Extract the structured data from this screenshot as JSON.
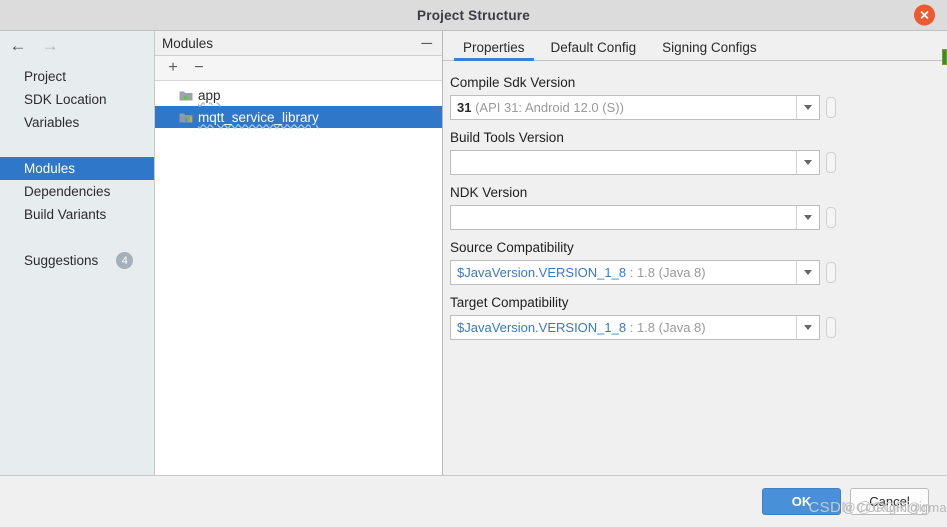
{
  "window": {
    "title": "Project Structure",
    "close_icon": "close-icon"
  },
  "navigation": {
    "back_icon": "arrow-left-icon",
    "forward_icon": "arrow-right-icon",
    "back_label": "←",
    "forward_label": "→"
  },
  "sidebar": {
    "items": [
      {
        "label": "Project",
        "selected": false
      },
      {
        "label": "SDK Location",
        "selected": false
      },
      {
        "label": "Variables",
        "selected": false
      },
      {
        "label": "Modules",
        "selected": true
      },
      {
        "label": "Dependencies",
        "selected": false
      },
      {
        "label": "Build Variants",
        "selected": false
      },
      {
        "label": "Suggestions",
        "selected": false,
        "badge": "4"
      }
    ]
  },
  "modules_panel": {
    "title": "Modules",
    "collapse_label": "─",
    "add_label": "+",
    "remove_label": "−",
    "items": [
      {
        "label": "app",
        "icon": "android-app-module-icon",
        "selected": false
      },
      {
        "label": "mqtt_service_library",
        "icon": "android-library-module-icon",
        "selected": true
      }
    ]
  },
  "tabs": [
    {
      "label": "Properties",
      "active": true
    },
    {
      "label": "Default Config",
      "active": false
    },
    {
      "label": "Signing Configs",
      "active": false
    }
  ],
  "properties": {
    "fields": [
      {
        "label": "Compile Sdk Version",
        "value_token": "31",
        "value_rest": " (API 31: Android 12.0 (S))",
        "variable": false
      },
      {
        "label": "Build Tools Version",
        "value_token": "",
        "value_rest": "",
        "variable": false
      },
      {
        "label": "NDK Version",
        "value_token": "",
        "value_rest": "",
        "variable": false
      },
      {
        "label": "Source Compatibility",
        "value_token": "$JavaVersion.VERSION_1_8",
        "value_rest": " : 1.8 (Java 8)",
        "variable": true
      },
      {
        "label": "Target Compatibility",
        "value_token": "$JavaVersion.VERSION_1_8",
        "value_rest": " : 1.8 (Java 8)",
        "variable": true
      }
    ]
  },
  "footer": {
    "ok_label": "OK",
    "cancel_label": "Cancel",
    "watermark_primary": "CSDN @CORigin",
    "watermark_secondary": "@CORigin@gmail"
  },
  "colors": {
    "accent_blue": "#2f77c9",
    "tab_underline": "#3a7fd5",
    "close_red": "#ee5a30",
    "ok_blue": "#4a90d9",
    "badge_gray": "#a6b0b8",
    "variable_blue": "#3b78c4",
    "marker_green": "#3c8a2e"
  }
}
